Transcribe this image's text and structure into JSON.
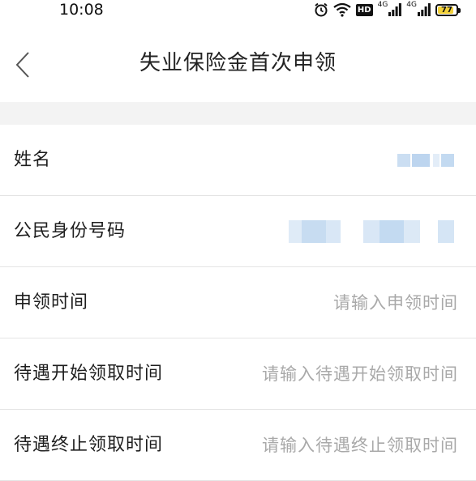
{
  "status_bar": {
    "time": "10:08",
    "icons": [
      "alarm-icon",
      "wifi-icon",
      "hd-icon",
      "signal-4g-icon",
      "signal-4g-icon",
      "battery-icon"
    ],
    "hd_label": "HD",
    "signal1_label": "4G",
    "signal2_label": "4G",
    "battery_level": "77",
    "battery_color": "#f2d13a"
  },
  "header": {
    "back_icon": "chevron-left-icon",
    "title": "失业保险金首次申领"
  },
  "form": {
    "fields": [
      {
        "label": "姓名",
        "value_masked": true
      },
      {
        "label": "公民身份号码",
        "value_masked": true
      },
      {
        "label": "申领时间",
        "placeholder": "请输入申领时间",
        "value": ""
      },
      {
        "label": "待遇开始领取时间",
        "placeholder": "请输入待遇开始领取时间",
        "value": ""
      },
      {
        "label": "待遇终止领取时间",
        "placeholder": "请输入待遇终止领取时间",
        "value": ""
      }
    ]
  },
  "colors": {
    "divider": "#e4e4e4",
    "section_gap": "#f3f3f3",
    "placeholder": "#a9a9a9",
    "masked_block": "#b9d3ee"
  }
}
